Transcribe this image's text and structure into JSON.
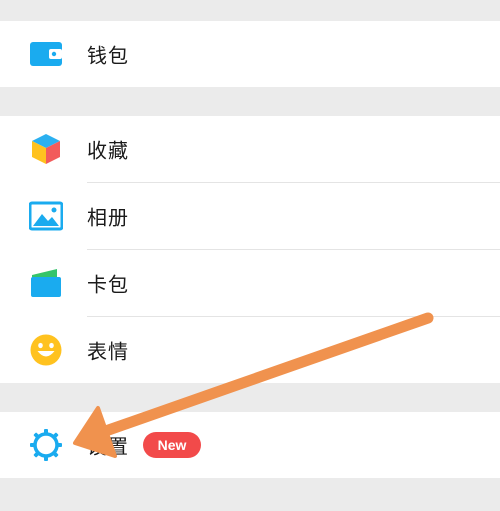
{
  "groups": [
    {
      "items": [
        {
          "label": "钱包",
          "icon": "wallet-icon"
        }
      ]
    },
    {
      "items": [
        {
          "label": "收藏",
          "icon": "favorites-cube-icon"
        },
        {
          "label": "相册",
          "icon": "album-icon"
        },
        {
          "label": "卡包",
          "icon": "card-wallet-icon"
        },
        {
          "label": "表情",
          "icon": "emoji-icon"
        }
      ]
    },
    {
      "items": [
        {
          "label": "设置",
          "icon": "gear-icon",
          "badge": "New"
        }
      ]
    }
  ],
  "colors": {
    "accent_blue": "#1aabef",
    "badge_red": "#f24a4a",
    "annotation_arrow": "#f0924e",
    "page_background": "#ebebeb"
  }
}
